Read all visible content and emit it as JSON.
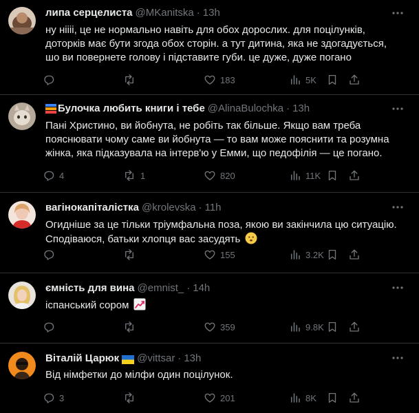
{
  "colors": {
    "background": "#000000",
    "text": "#e7e9ea",
    "muted": "#71767b",
    "divider": "#2f3336"
  },
  "tweets": [
    {
      "name": "липа серцелиста",
      "handle": "@MKanitska",
      "time": "13h",
      "text": "ну ніііі, це не нормально навіть для обох дорослих. для поцілунків, доторків має бути згода обох сторін. а тут дитина, яка не здогадується, шо ви повернете голову і підставите губи. це дуже, дуже погано",
      "replies": "",
      "retweets": "",
      "likes": "183",
      "views": "5K"
    },
    {
      "name": "Булочка любить книги і тебе",
      "name_emoji": "books-icon",
      "handle": "@AlinaBulochka",
      "time": "13h",
      "text": "Пані Христино, ви йобнута, не робіть так більше. Якщо вам треба пояснювати чому саме ви йобнута — то вам може пояснити та розумна жінка, яка підказувала на інтерв'ю у Емми, що педофілія — це погано.",
      "replies": "4",
      "retweets": "1",
      "likes": "820",
      "views": "11K"
    },
    {
      "name": "вагінокапіталістка",
      "handle": "@krolevska",
      "time": "11h",
      "text": "Огидніше за це тільки тріумфальна поза, якою ви закінчила цю ситуацію. Сподіваюся, батьки хлопця вас засудять",
      "text_emoji": "neutral-face-icon",
      "replies": "",
      "retweets": "",
      "likes": "155",
      "views": "3.2K"
    },
    {
      "name": "ємність для вина",
      "handle": "@emnist_",
      "time": "14h",
      "text": "іспанський сором",
      "text_emoji": "chart-increasing-icon",
      "replies": "",
      "retweets": "",
      "likes": "359",
      "views": "9.8K"
    },
    {
      "name": "Віталій Царюк",
      "name_emoji": "ukraine-flag-icon",
      "handle": "@vittsar",
      "time": "13h",
      "text": "Від німфетки до мілфи один поцілунок.",
      "replies": "3",
      "retweets": "",
      "likes": "201",
      "views": "8K"
    }
  ]
}
